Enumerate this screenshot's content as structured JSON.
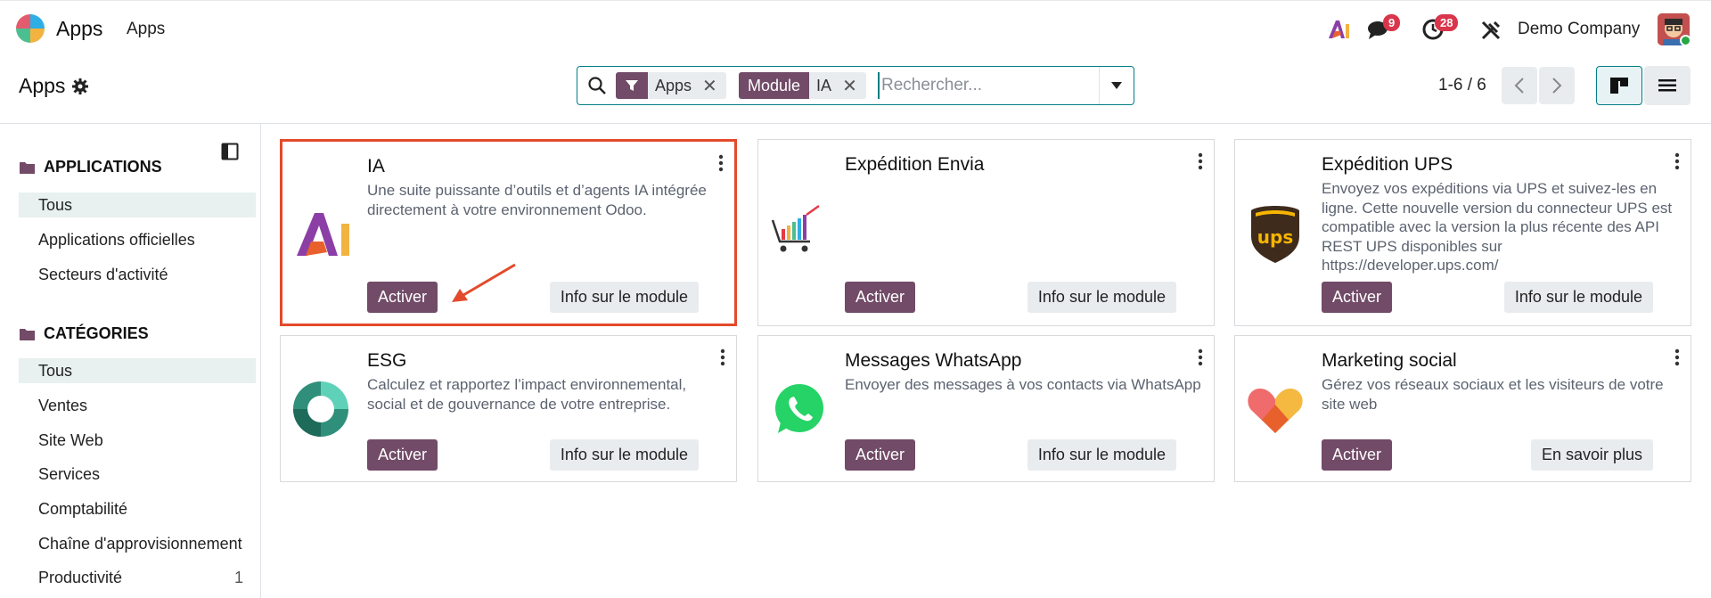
{
  "navbar": {
    "app_name": "Apps",
    "menu_item": "Apps",
    "chat_count": "9",
    "activity_count": "28",
    "company": "Demo Company"
  },
  "control_panel": {
    "title": "Apps",
    "facets": [
      {
        "label": "",
        "value": "Apps",
        "icon": "filter-icon"
      },
      {
        "label": "Module",
        "value": "IA"
      }
    ],
    "search_placeholder": "Rechercher...",
    "pager": "1-6 / 6"
  },
  "sidebar": {
    "sections": [
      {
        "title": "APPLICATIONS",
        "items": [
          {
            "label": "Tous",
            "active": true
          },
          {
            "label": "Applications officielles"
          },
          {
            "label": "Secteurs d'activité"
          }
        ]
      },
      {
        "title": "CATÉGORIES",
        "items": [
          {
            "label": "Tous",
            "active": true
          },
          {
            "label": "Ventes"
          },
          {
            "label": "Site Web"
          },
          {
            "label": "Services"
          },
          {
            "label": "Comptabilité"
          },
          {
            "label": "Chaîne d'approvisionnement"
          },
          {
            "label": "Productivité",
            "count": "1"
          }
        ]
      }
    ]
  },
  "cards": [
    {
      "title": "IA",
      "description": "Une suite puissante d’outils et d’agents IA intégrée directement à votre environnement Odoo.",
      "primary": "Activer",
      "secondary": "Info sur le module",
      "icon": "ai-logo-icon"
    },
    {
      "title": "Expédition Envia",
      "description": "",
      "primary": "Activer",
      "secondary": "Info sur le module",
      "icon": "envia-cart-icon"
    },
    {
      "title": "Expédition UPS",
      "description": "Envoyez vos expéditions via UPS et suivez-les en ligne. Cette nouvelle version du connecteur UPS est compatible avec la version la plus récente des API REST UPS disponibles sur https://developer.ups.com/",
      "primary": "Activer",
      "secondary": "Info sur le module",
      "icon": "ups-shield-icon"
    },
    {
      "title": "ESG",
      "description": "Calculez et rapportez l’impact environnemental, social et de gouvernance de votre entreprise.",
      "primary": "Activer",
      "secondary": "Info sur le module",
      "icon": "esg-ring-icon"
    },
    {
      "title": "Messages WhatsApp",
      "description": "Envoyer des messages à vos contacts via WhatsApp",
      "primary": "Activer",
      "secondary": "Info sur le module",
      "icon": "whatsapp-icon"
    },
    {
      "title": "Marketing social",
      "description": "Gérez vos réseaux sociaux et les visiteurs de votre site web",
      "primary": "Activer",
      "secondary": "En savoir plus",
      "icon": "social-heart-icon"
    }
  ],
  "colors": {
    "brand": "#714b67",
    "accent": "#017e84",
    "highlight": "#e34a2b",
    "badge": "#d9364c"
  }
}
